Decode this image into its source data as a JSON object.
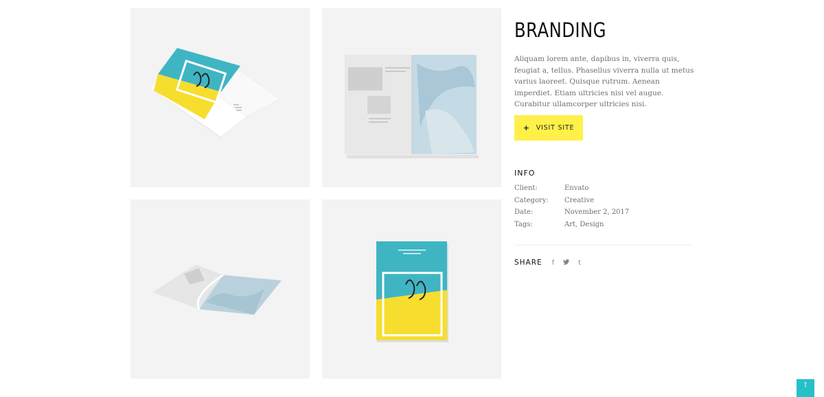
{
  "project": {
    "title": "BRANDING",
    "description": "Aliquam lorem ante, dapibus in, viverra quis, feugiat a, tellus. Phasellus viverra nulla ut metus varius laoreet. Quisque rutrum. Aenean imperdiet. Etiam ultricies nisi vel augue. Curabitur ullamcorper ultricies nisi."
  },
  "visit_button": {
    "icon": "+",
    "label": "VISIT SITE",
    "color": "#fff04a"
  },
  "info": {
    "heading": "INFO",
    "rows": [
      {
        "key": "Client:",
        "value": "Envato"
      },
      {
        "key": "Category:",
        "value": "Creative"
      },
      {
        "key": "Date:",
        "value": "November 2, 2017"
      },
      {
        "key": "Tags:",
        "value": "Art, Design"
      }
    ]
  },
  "share": {
    "label": "SHARE",
    "icons": [
      "facebook-icon",
      "twitter-icon",
      "tumblr-icon"
    ],
    "glyphs": [
      "f",
      "❦",
      "t"
    ]
  },
  "scroll_top": {
    "glyph": "↑",
    "color": "#26c0c8"
  },
  "colors": {
    "teal": "#3fb5c4",
    "yellow": "#f7dd2e",
    "tile_bg": "#f3f3f3"
  }
}
